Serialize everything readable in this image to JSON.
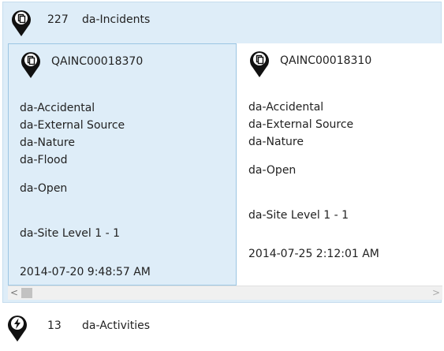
{
  "incidents": {
    "count": "227",
    "title": "da-Incidents",
    "cards": [
      {
        "id": "QAINC00018370",
        "lines": [
          "da-Accidental",
          "da-External Source",
          "da-Nature",
          "da-Flood"
        ],
        "status": "da-Open",
        "site": "da-Site Level 1 - 1",
        "date": "2014-07-20 9:48:57 AM",
        "selected": true
      },
      {
        "id": "QAINC00018310",
        "lines": [
          "da-Accidental",
          "da-External Source",
          "da-Nature"
        ],
        "status": "da-Open",
        "site": "da-Site Level 1 - 1",
        "date": "2014-07-25 2:12:01 AM",
        "selected": false
      }
    ],
    "scrollbar": {
      "left_arrow": "<",
      "right_arrow": ">"
    }
  },
  "activities": {
    "count": "13",
    "title": "da-Activities"
  },
  "icons": {
    "incident": "incident-map-pin-icon",
    "activity": "activity-lightning-pin-icon"
  }
}
